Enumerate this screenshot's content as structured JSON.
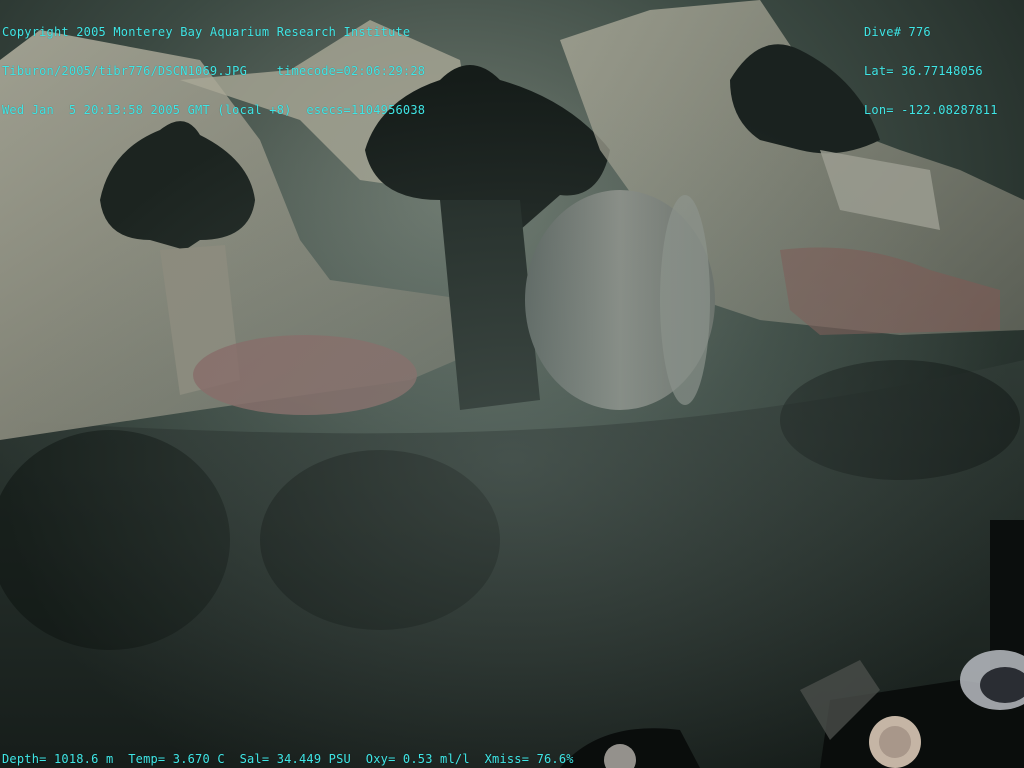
{
  "overlay": {
    "top_left": {
      "line1": "Copyright 2005 Monterey Bay Aquarium Research Institute",
      "line2": "Tiburon/2005/tibr776/DSCN1069.JPG    timecode=02:06:29:28",
      "line3": "Wed Jan  5 20:13:58 2005 GMT (local +8)  esecs=1104956038"
    },
    "top_right": {
      "dive": "Dive# 776",
      "lat": "Lat= 36.77148056",
      "lon": "Lon= -122.08287811"
    },
    "bottom": "Depth= 1018.6 m  Temp= 3.670 C  Sal= 34.449 PSU  Oxy= 0.53 ml/l  Xmiss= 76.6%"
  },
  "colors": {
    "overlay_text": "#3fe6e6",
    "water": "#1f2d29",
    "bone": "#9a9a8c",
    "sediment": "#2a332e"
  }
}
